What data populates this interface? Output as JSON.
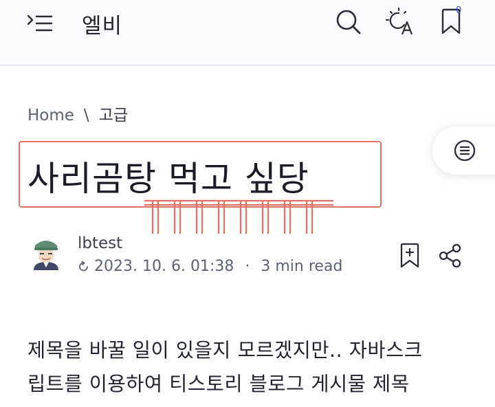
{
  "header": {
    "site_title": "엘비",
    "menu_icon": "menu-icon",
    "search_icon": "search-icon",
    "theme_icon": "theme-toggle-icon",
    "bookmark_icon": "bookmark-icon",
    "bookmark_count": "0"
  },
  "breadcrumb": {
    "home": "Home",
    "separator": "\\",
    "category": "고급"
  },
  "toc_icon": "table-of-contents-icon",
  "post": {
    "title": "사리곰탕 먹고 싶당",
    "author": "lbtest",
    "updated_icon": "refresh-icon",
    "date": "2023. 10. 6. 01:38",
    "meta_separator": "·",
    "read_time": "3 min read",
    "body_lines": [
      "제목을 바꿀 일이 있을지 모르겠지만.. 자바스크",
      "립트를 이용하여 티스토리 블로그 게시물 제목"
    ]
  },
  "actions": {
    "save_icon": "bookmark-add-icon",
    "share_icon": "share-icon"
  },
  "colors": {
    "highlight_border": "#e07264",
    "badge": "#2a5ad8",
    "text": "#1f1f2e",
    "muted": "#5d6273"
  }
}
